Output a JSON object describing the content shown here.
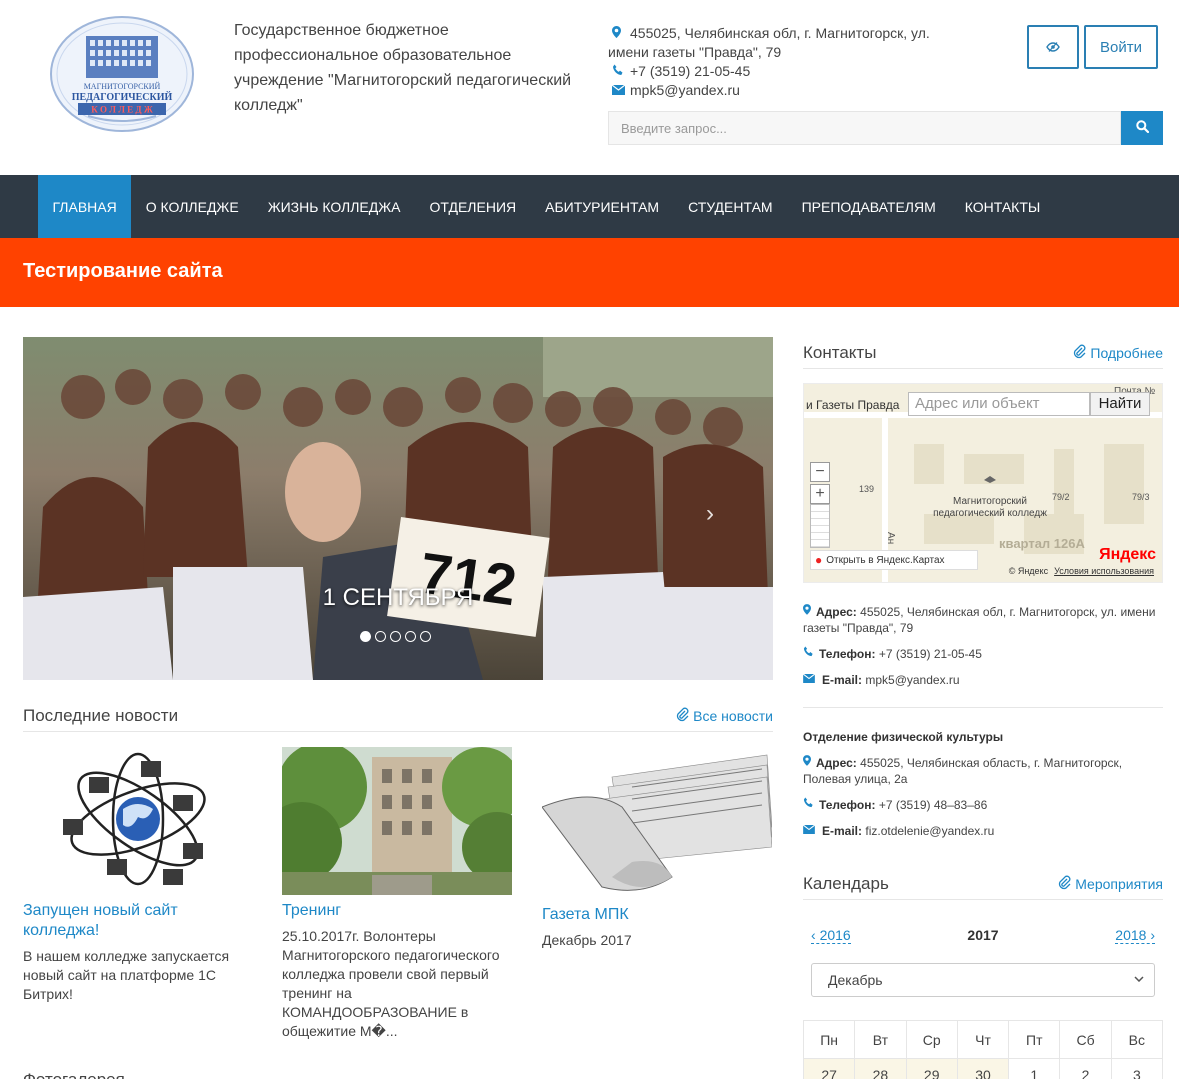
{
  "header": {
    "logo": {
      "line1": "МАГНИТОГОРСКИЙ",
      "line2": "ПЕДАГОГИЧЕСКИЙ",
      "line3": "К О Л Л Е Д Ж"
    },
    "org_name": "Государственное бюджетное профессиональное образовательное учреждение \"Магнитогорский педагогический колледж\"",
    "address": "455025, Челябинская обл, г. Магнитогорск, ул. имени газеты \"Правда\", 79",
    "phone": "+7 (3519) 21-05-45",
    "email": "mpk5@yandex.ru",
    "login_label": "Войти",
    "search_placeholder": "Введите запрос..."
  },
  "nav": {
    "items": [
      {
        "label": "ГЛАВНАЯ",
        "active": true
      },
      {
        "label": "О КОЛЛЕДЖЕ"
      },
      {
        "label": "ЖИЗНЬ КОЛЛЕДЖА"
      },
      {
        "label": "ОТДЕЛЕНИЯ"
      },
      {
        "label": "АБИТУРИЕНТАМ"
      },
      {
        "label": "СТУДЕНТАМ"
      },
      {
        "label": "ПРЕПОДАВАТЕЛЯМ"
      },
      {
        "label": "КОНТАКТЫ"
      }
    ]
  },
  "banner": {
    "title": "Тестирование сайта",
    "color": "#ff4200"
  },
  "slider": {
    "caption": "1 СЕНТЯБРЯ",
    "sign_number": "712",
    "slides_count": 5,
    "active_slide": 1
  },
  "news": {
    "heading": "Последние новости",
    "all_link": "Все новости",
    "items": [
      {
        "title": "Запущен новый сайт колледжа!",
        "text": "В нашем колледже запускается новый сайт на платформе 1С Битрих!"
      },
      {
        "title": "Тренинг",
        "text": "25.10.2017г. Волонтеры Магнитогорского педагогического колледжа провели свой первый тренинг на КОМАНДООБРАЗОВАНИЕ в общежитие М�..."
      },
      {
        "title": "Газета МПК",
        "text": "Декабрь 2017"
      }
    ]
  },
  "contacts": {
    "heading": "Контакты",
    "more_link": "Подробнее",
    "map": {
      "street": "и Газеты Правда",
      "search_placeholder": "Адрес или объект",
      "find_label": "Найти",
      "label": "Магнитогорский педагогический колледж",
      "open_label": "Открыть в Яндекс.Картах",
      "copyright": "© Яндекс",
      "terms": "Условия использования",
      "brand": "Яндекс",
      "district": "квартал 126А",
      "nums": [
        "139",
        "79/2",
        "79/3"
      ],
      "post": "Почта №",
      "side_street": "Ан"
    },
    "main": {
      "address_label": "Адрес:",
      "address": "455025, Челябинская обл, г. Магнитогорск, ул. имени газеты \"Правда\", 79",
      "phone_label": "Телефон:",
      "phone": "+7 (3519) 21-05-45",
      "email_label": "E-mail:",
      "email": "mpk5@yandex.ru"
    },
    "dept": {
      "title": "Отделение физической культуры",
      "address_label": "Адрес:",
      "address": "455025, Челябинская область, г. Магнитогорск, Полевая улица, 2а",
      "phone_label": "Телефон:",
      "phone": "+7 (3519) 48–83–86",
      "email_label": "E-mail:",
      "email": "fiz.otdelenie@yandex.ru"
    }
  },
  "calendar": {
    "heading": "Календарь",
    "events_link": "Мероприятия",
    "prev_year": "2016",
    "current_year": "2017",
    "next_year": "2018",
    "month": "Декабрь",
    "weekdays": [
      "Пн",
      "Вт",
      "Ср",
      "Чт",
      "Пт",
      "Сб",
      "Вс"
    ],
    "first_row": [
      "27",
      "28",
      "29",
      "30",
      "1",
      "2",
      "3"
    ]
  },
  "photo_heading": "Фотогалерея",
  "colors": {
    "accent": "#1e88c7",
    "nav_bg": "#2f3a45",
    "banner": "#ff4200"
  }
}
